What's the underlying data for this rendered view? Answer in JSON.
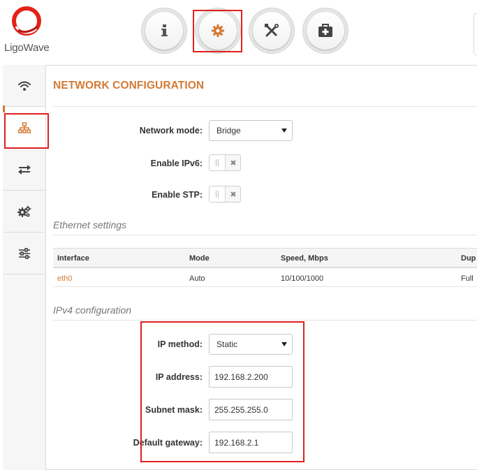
{
  "brand": {
    "name": "LigoWave"
  },
  "top_nav": [
    {
      "name": "info",
      "icon": "info-icon"
    },
    {
      "name": "settings",
      "icon": "gear-icon",
      "selected": true
    },
    {
      "name": "tools",
      "icon": "tools-icon"
    },
    {
      "name": "support",
      "icon": "first-aid-kit-icon"
    }
  ],
  "side_nav": [
    {
      "name": "wireless",
      "icon": "wifi-icon"
    },
    {
      "name": "network",
      "icon": "network-tree-icon",
      "active": true
    },
    {
      "name": "routing",
      "icon": "arrows-exchange-icon"
    },
    {
      "name": "services",
      "icon": "gears-icon"
    },
    {
      "name": "system",
      "icon": "sliders-icon"
    }
  ],
  "page": {
    "title": "NETWORK CONFIGURATION"
  },
  "network": {
    "mode_label": "Network mode:",
    "mode_value": "Bridge",
    "ipv6_label": "Enable IPv6:",
    "ipv6_enabled": false,
    "stp_label": "Enable STP:",
    "stp_enabled": false,
    "toggle_off_glyph": "✖"
  },
  "ethernet": {
    "section_title": "Ethernet settings",
    "columns": [
      "Interface",
      "Mode",
      "Speed, Mbps",
      "Dup"
    ],
    "rows": [
      {
        "interface": "eth0",
        "mode": "Auto",
        "speed": "10/100/1000",
        "duplex": "Full"
      }
    ]
  },
  "ipv4": {
    "section_title": "IPv4 configuration",
    "method_label": "IP method:",
    "method_value": "Static",
    "address_label": "IP address:",
    "address_value": "192.168.2.200",
    "netmask_label": "Subnet mask:",
    "netmask_value": "255.255.255.0",
    "gateway_label": "Default gateway:",
    "gateway_value": "192.168.2.1"
  },
  "colors": {
    "accent": "#d47a35",
    "highlight_box": "#e02020",
    "logo_red": "#e2231a"
  }
}
